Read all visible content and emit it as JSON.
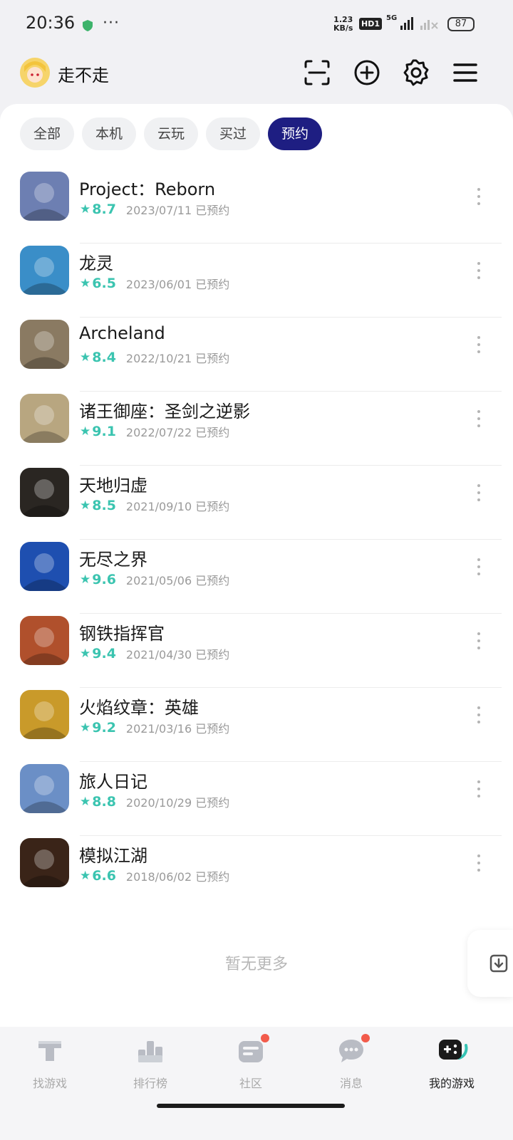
{
  "status_bar": {
    "time": "20:36",
    "net_speed_value": "1.23",
    "net_speed_unit": "KB/s",
    "hd_label": "HD1",
    "net_type": "5G",
    "battery": "87"
  },
  "header": {
    "username": "走不走",
    "icons": [
      "scan-icon",
      "add-icon",
      "settings-icon",
      "menu-icon"
    ]
  },
  "tabs": [
    {
      "label": "全部",
      "active": false
    },
    {
      "label": "本机",
      "active": false
    },
    {
      "label": "云玩",
      "active": false
    },
    {
      "label": "买过",
      "active": false
    },
    {
      "label": "预约",
      "active": true
    }
  ],
  "games": [
    {
      "name": "Project：Reborn",
      "score": "8.7",
      "date": "2023/07/11 已预约",
      "color": "#6d7fb2"
    },
    {
      "name": "龙灵",
      "score": "6.5",
      "date": "2023/06/01 已预约",
      "color": "#3a8ec8"
    },
    {
      "name": "Archeland",
      "score": "8.4",
      "date": "2022/10/21 已预约",
      "color": "#8a7a62"
    },
    {
      "name": "诸王御座：圣剑之逆影",
      "score": "9.1",
      "date": "2022/07/22 已预约",
      "color": "#b8a680"
    },
    {
      "name": "天地归虚",
      "score": "8.5",
      "date": "2021/09/10 已预约",
      "color": "#2a2622"
    },
    {
      "name": "无尽之界",
      "score": "9.6",
      "date": "2021/05/06 已预约",
      "color": "#1e4fb0"
    },
    {
      "name": "钢铁指挥官",
      "score": "9.4",
      "date": "2021/04/30 已预约",
      "color": "#b0502c"
    },
    {
      "name": "火焰纹章：英雄",
      "score": "9.2",
      "date": "2021/03/16 已预约",
      "color": "#c99a2a"
    },
    {
      "name": "旅人日记",
      "score": "8.8",
      "date": "2020/10/29 已预约",
      "color": "#6b8fc6"
    },
    {
      "name": "模拟江湖",
      "score": "6.6",
      "date": "2018/06/02 已预约",
      "color": "#3a2418"
    }
  ],
  "footer_text": "暂无更多",
  "bottom_nav": [
    {
      "label": "找游戏",
      "icon": "find-games-icon",
      "active": false,
      "badge": false
    },
    {
      "label": "排行榜",
      "icon": "ranking-icon",
      "active": false,
      "badge": false
    },
    {
      "label": "社区",
      "icon": "community-icon",
      "active": false,
      "badge": true
    },
    {
      "label": "消息",
      "icon": "message-icon",
      "active": false,
      "badge": true
    },
    {
      "label": "我的游戏",
      "icon": "my-games-icon",
      "active": true,
      "badge": false
    }
  ],
  "colors": {
    "accent": "#1e1e82",
    "score": "#3bc4b0",
    "badge": "#f25b4b"
  }
}
